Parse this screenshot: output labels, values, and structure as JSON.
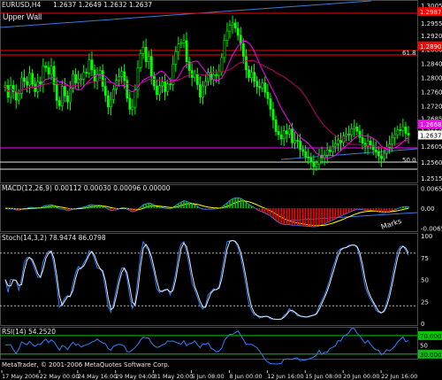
{
  "chart_data": [
    {
      "type": "candlestick",
      "panel": "price",
      "symbol_label": "EURUSD,H4",
      "ohlc_label": "1.2637 1.2649 1.2632 1.2637",
      "object_labels": {
        "upper_wall": "Upper Wall",
        "lower": "Marks"
      },
      "yticks": [
        "1.3005",
        "1.2955",
        "1.2920",
        "1.2880",
        "1.2840",
        "1.2800",
        "1.2760",
        "1.2720",
        "1.2685",
        "1.2650",
        "1.2605",
        "1.2560",
        "1.2515"
      ],
      "ylim": [
        1.2505,
        1.3015
      ],
      "price_tags": [
        {
          "value": "1.2987",
          "color": "#ff0000"
        },
        {
          "value": "1.2890",
          "color": "#ff0000"
        },
        {
          "value": "1.2668",
          "color": "#ff00ff"
        },
        {
          "value": "1.2637",
          "color": "#ffffff"
        }
      ],
      "fib_labels": [
        "61.8",
        "50.0"
      ],
      "candles": [
        1.2778,
        1.2744,
        1.2778,
        1.276,
        1.2736,
        1.2755,
        1.2799,
        1.2789,
        1.2779,
        1.2812,
        1.2782,
        1.276,
        1.2788,
        1.2781,
        1.2833,
        1.2828,
        1.281,
        1.2832,
        1.278,
        1.2735,
        1.272,
        1.2775,
        1.2748,
        1.2731,
        1.2769,
        1.2809,
        1.2785,
        1.2796,
        1.2796,
        1.2815,
        1.2813,
        1.285,
        1.2822,
        1.279,
        1.2808,
        1.282,
        1.2775,
        1.2749,
        1.2717,
        1.2738,
        1.2767,
        1.2792,
        1.2803,
        1.2817,
        1.2792,
        1.2742,
        1.271,
        1.2716,
        1.2766,
        1.2828,
        1.2868,
        1.2886,
        1.2845,
        1.286,
        1.2804,
        1.2776,
        1.2752,
        1.2777,
        1.2788,
        1.276,
        1.2782,
        1.278,
        1.2838,
        1.2874,
        1.2895,
        1.2898,
        1.2905,
        1.2845,
        1.282,
        1.28,
        1.281,
        1.278,
        1.2745,
        1.2776,
        1.2789,
        1.2815,
        1.2794,
        1.2808,
        1.2806,
        1.2817,
        1.2857,
        1.2905,
        1.2932,
        1.2948,
        1.2955,
        1.294,
        1.292,
        1.2896,
        1.286,
        1.2822,
        1.28,
        1.2815,
        1.279,
        1.2775,
        1.2771,
        1.2785,
        1.2758,
        1.274,
        1.271,
        1.268,
        1.2647,
        1.2638,
        1.2626,
        1.2649,
        1.264,
        1.2654,
        1.2615,
        1.2622,
        1.262,
        1.2596,
        1.259,
        1.2575,
        1.2572,
        1.256,
        1.2547,
        1.2555,
        1.258,
        1.2572,
        1.258,
        1.2595,
        1.259,
        1.2605,
        1.2612,
        1.2623,
        1.2616,
        1.2634,
        1.264,
        1.2638,
        1.2655,
        1.266,
        1.2648,
        1.263,
        1.2614,
        1.2605,
        1.262,
        1.2608,
        1.2595,
        1.259,
        1.2578,
        1.257,
        1.2585,
        1.2602,
        1.2611,
        1.263,
        1.2638,
        1.2652,
        1.265,
        1.266,
        1.2642,
        1.2637
      ]
    },
    {
      "type": "line",
      "panel": "macd",
      "label": "MACD(12,26,9) 0.00112 0.00030 0.00096 0.00000",
      "yticks": [
        "0.0065",
        "0.00",
        "-0.0065"
      ],
      "ylim": [
        -0.0072,
        0.0072
      ]
    },
    {
      "type": "line",
      "panel": "stoch",
      "label": "Stoch(14,3,2) 78.9474 86.0798",
      "yticks": [
        "100",
        "75",
        "50",
        "25",
        "0"
      ],
      "levels": [
        80,
        20
      ],
      "ylim": [
        0,
        100
      ]
    },
    {
      "type": "line",
      "panel": "rsi",
      "label": "RSI(14) 54.2520",
      "yticks": [
        "70.0000",
        "50",
        "30.0000"
      ],
      "levels": [
        70,
        30
      ],
      "ylim": [
        20,
        85
      ]
    }
  ],
  "xticks": [
    "17 May 2006",
    "22 May 00:00",
    "24 May 16:00",
    "29 May 04:00",
    "31 May 20:00",
    "5 Jun 08:00",
    "8 Jun 00:00",
    "12 Jun 16:00",
    "15 Jun 08:00",
    "20 Jun 00:00",
    "22 Jun 16:00"
  ],
  "footer": "MetaTrader, © 2001-2006 MetaQuotes Software Corp."
}
